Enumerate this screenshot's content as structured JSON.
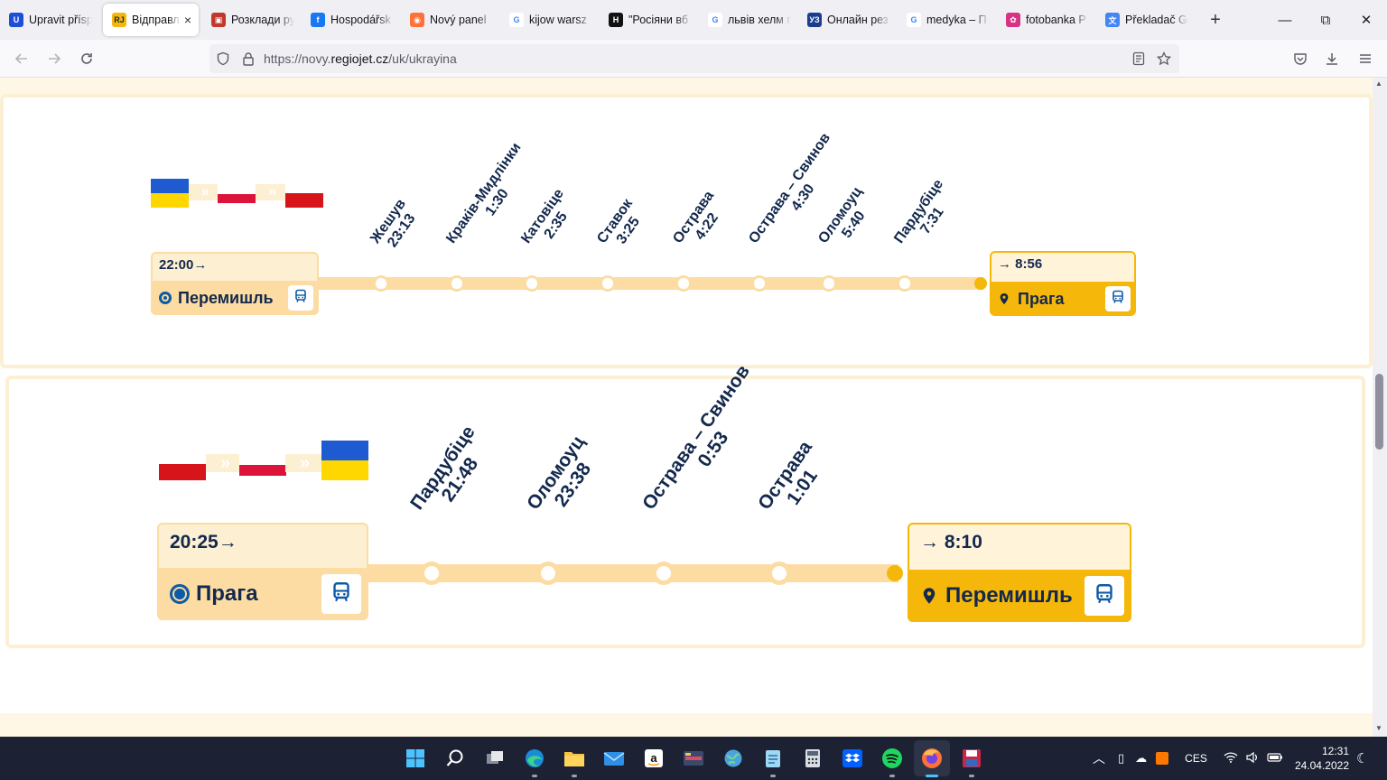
{
  "browser": {
    "tabs": [
      {
        "title": "Upravit přísp",
        "icon": "ucoz-icon",
        "color": "#1d4ed8"
      },
      {
        "title": "Відправлн",
        "icon": "regiojet-icon",
        "color": "#f5b80a"
      },
      {
        "title": "Розклади ру",
        "icon": "train-icon",
        "color": "#c0392b"
      },
      {
        "title": "Hospodářsk",
        "icon": "facebook-icon",
        "color": "#1877f2"
      },
      {
        "title": "Nový panel",
        "icon": "firefox-icon",
        "color": "#ff7139"
      },
      {
        "title": "kijow warsz",
        "icon": "google-icon",
        "color": "#4285f4"
      },
      {
        "title": "\"Росіяни вб",
        "icon": "news-icon",
        "color": "#111111"
      },
      {
        "title": "львів хелм п",
        "icon": "google-icon",
        "color": "#4285f4"
      },
      {
        "title": "Онлайн рез",
        "icon": "uz-icon",
        "color": "#1a3d8f"
      },
      {
        "title": "medyka – П",
        "icon": "google-icon",
        "color": "#4285f4"
      },
      {
        "title": "fotobanka P",
        "icon": "fotobanka-icon",
        "color": "#d63384"
      },
      {
        "title": "Překladač Go",
        "icon": "translate-icon",
        "color": "#4285f4"
      }
    ],
    "active_tab_close": "×",
    "new_tab": "+",
    "url_prefix": "https://novy.",
    "url_domain": "regiojet.cz",
    "url_path": "/uk/ukrayina",
    "win_min": "—",
    "win_max": "⧉",
    "win_close": "✕"
  },
  "routes": [
    {
      "flags": [
        "ukraine-flag",
        "poland-flag",
        "czech-flag"
      ],
      "chevrons": "»",
      "departure": {
        "time": "22:00",
        "arrow": "→",
        "city": "Перемишль"
      },
      "stops": [
        {
          "name": "Жешув",
          "time": "23:13"
        },
        {
          "name": "Краків-Мидлінки",
          "time": "1:30"
        },
        {
          "name": "Катовіце",
          "time": "2:35"
        },
        {
          "name": "Ставок",
          "time": "3:25"
        },
        {
          "name": "Острава",
          "time": "4:22"
        },
        {
          "name": "Острава – Свинов",
          "time": "4:30"
        },
        {
          "name": "Оломоуц",
          "time": "5:40"
        },
        {
          "name": "Пардубіце",
          "time": "7:31"
        }
      ],
      "arrival": {
        "time": "8:56",
        "arrow": "→",
        "city": "Прага"
      }
    },
    {
      "flags": [
        "czech-flag",
        "poland-flag",
        "ukraine-flag"
      ],
      "chevrons": "»",
      "departure": {
        "time": "20:25",
        "arrow": "→",
        "city": "Прага"
      },
      "stops": [
        {
          "name": "Пардубіце",
          "time": "21:48"
        },
        {
          "name": "Оломоуц",
          "time": "23:38"
        },
        {
          "name": "Острава – Свинов",
          "time": "0:53"
        },
        {
          "name": "Острава",
          "time": "1:01"
        }
      ],
      "arrival": {
        "time": "8:10",
        "arrow": "→",
        "city": "Перемишль"
      }
    }
  ],
  "colors": {
    "accent": "#f5b80a",
    "track": "#fcdca2",
    "navy": "#13284d",
    "blue": "#0d5aa7"
  },
  "taskbar": {
    "apps": [
      "windows-start-icon",
      "search-icon",
      "task-view-icon",
      "edge-icon",
      "file-explorer-icon",
      "mail-icon",
      "amazon-icon",
      "media-icon",
      "globe-icon",
      "notepad-icon",
      "calculator-icon",
      "dropbox-icon",
      "spotify-icon",
      "firefox-icon",
      "save-icon"
    ],
    "lang": "CES",
    "time": "12:31",
    "date": "24.04.2022"
  }
}
